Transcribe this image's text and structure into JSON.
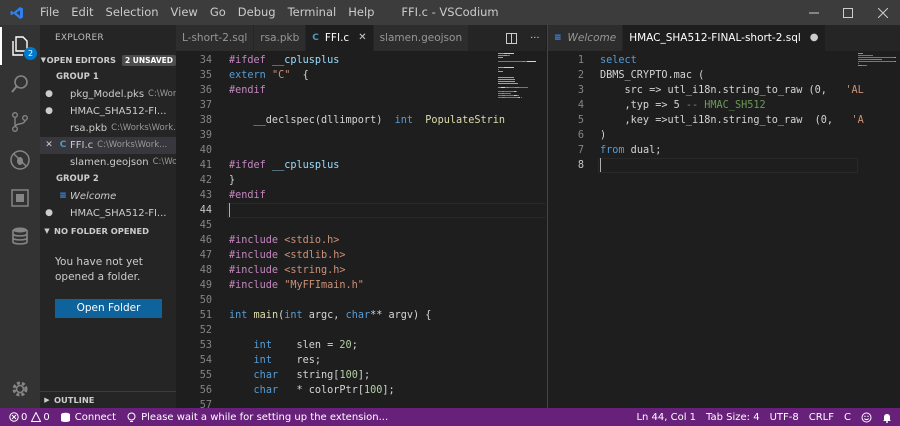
{
  "window": {
    "title": "FFI.c - VSCodium"
  },
  "menu": [
    "File",
    "Edit",
    "Selection",
    "View",
    "Go",
    "Debug",
    "Terminal",
    "Help"
  ],
  "activity": {
    "explorer_badge": "2"
  },
  "sidebar": {
    "title": "EXPLORER",
    "open_editors": {
      "label": "OPEN EDITORS",
      "badge": "2 UNSAVED"
    },
    "group1": {
      "label": "GROUP 1",
      "items": [
        {
          "mark": "●",
          "icon": "",
          "name": "pkg_Model.pks",
          "path": "C:\\Works\\W...",
          "icon_color": "#cccccc"
        },
        {
          "mark": "●",
          "icon": "",
          "name": "HMAC_SHA512-FI...",
          "path": "",
          "icon_color": "#cccccc"
        },
        {
          "mark": "",
          "icon": "",
          "name": "rsa.pkb",
          "path": "C:\\Works\\Work...",
          "icon_color": "#cccccc"
        },
        {
          "mark": "✕",
          "icon": "C",
          "name": "FFI.c",
          "path": "C:\\Works\\Work...",
          "icon_color": "#519aba"
        },
        {
          "mark": "",
          "icon": "",
          "name": "slamen.geojson",
          "path": "C:\\Works\\...",
          "icon_color": "#cccccc"
        }
      ]
    },
    "group2": {
      "label": "GROUP 2",
      "items": [
        {
          "mark": "",
          "icon": "≡",
          "name": "Welcome",
          "path": "",
          "icon_color": "#3794ff"
        },
        {
          "mark": "●",
          "icon": "",
          "name": "HMAC_SHA512-FI...",
          "path": "",
          "icon_color": "#cccccc"
        }
      ]
    },
    "no_folder": {
      "label": "NO FOLDER OPENED",
      "message": "You have not yet opened a folder.",
      "button": "Open Folder"
    },
    "outline": "OUTLINE"
  },
  "editor_left": {
    "tabs": [
      {
        "label": "L-short-2.sql",
        "icon": "",
        "active": false,
        "close": ""
      },
      {
        "label": "rsa.pkb",
        "icon": "",
        "active": false,
        "close": ""
      },
      {
        "label": "FFI.c",
        "icon": "C",
        "active": true,
        "close": "✕"
      },
      {
        "label": "slamen.geojson",
        "icon": "",
        "active": false,
        "close": ""
      }
    ],
    "current_line": "44",
    "lines": [
      {
        "n": "34",
        "tokens": [
          [
            "pp",
            "#ifdef "
          ],
          [
            "v",
            "__cplusplus"
          ]
        ]
      },
      {
        "n": "35",
        "tokens": [
          [
            "k",
            "extern "
          ],
          [
            "s",
            "\"C\""
          ],
          [
            "",
            "  {"
          ]
        ]
      },
      {
        "n": "36",
        "tokens": [
          [
            "pp",
            "#endif"
          ]
        ]
      },
      {
        "n": "37",
        "tokens": []
      },
      {
        "n": "38",
        "tokens": [
          [
            "",
            "    __declspec(dllimport)  "
          ],
          [
            "k",
            "int"
          ],
          [
            "",
            "  "
          ],
          [
            "f",
            "PopulateStrin"
          ]
        ]
      },
      {
        "n": "39",
        "tokens": []
      },
      {
        "n": "40",
        "tokens": []
      },
      {
        "n": "41",
        "tokens": [
          [
            "pp",
            "#ifdef "
          ],
          [
            "v",
            "__cplusplus"
          ]
        ]
      },
      {
        "n": "42",
        "tokens": [
          [
            "",
            "}"
          ]
        ]
      },
      {
        "n": "43",
        "tokens": [
          [
            "pp",
            "#endif"
          ]
        ]
      },
      {
        "n": "44",
        "tokens": []
      },
      {
        "n": "45",
        "tokens": []
      },
      {
        "n": "46",
        "tokens": [
          [
            "pp",
            "#include "
          ],
          [
            "s",
            "<stdio.h>"
          ]
        ]
      },
      {
        "n": "47",
        "tokens": [
          [
            "pp",
            "#include "
          ],
          [
            "s",
            "<stdlib.h>"
          ]
        ]
      },
      {
        "n": "48",
        "tokens": [
          [
            "pp",
            "#include "
          ],
          [
            "s",
            "<string.h>"
          ]
        ]
      },
      {
        "n": "49",
        "tokens": [
          [
            "pp",
            "#include "
          ],
          [
            "s",
            "\"MyFFImain.h\""
          ]
        ]
      },
      {
        "n": "50",
        "tokens": []
      },
      {
        "n": "51",
        "tokens": [
          [
            "k",
            "int"
          ],
          [
            "",
            ""
          ],
          [
            "f",
            " main"
          ],
          [
            "",
            "("
          ],
          [
            "k",
            "int"
          ],
          [
            "",
            " argc, "
          ],
          [
            "k",
            "char"
          ],
          [
            "",
            "** argv) {"
          ]
        ]
      },
      {
        "n": "52",
        "tokens": []
      },
      {
        "n": "53",
        "tokens": [
          [
            "",
            "    "
          ],
          [
            "k",
            "int"
          ],
          [
            "",
            "    slen = "
          ],
          [
            "n",
            "20"
          ],
          [
            "",
            ";"
          ]
        ]
      },
      {
        "n": "54",
        "tokens": [
          [
            "",
            "    "
          ],
          [
            "k",
            "int"
          ],
          [
            "",
            "    res;"
          ]
        ]
      },
      {
        "n": "55",
        "tokens": [
          [
            "",
            "    "
          ],
          [
            "k",
            "char"
          ],
          [
            "",
            "   string["
          ],
          [
            "n",
            "100"
          ],
          [
            "",
            "];"
          ]
        ]
      },
      {
        "n": "56",
        "tokens": [
          [
            "",
            "    "
          ],
          [
            "k",
            "char"
          ],
          [
            "",
            "   * colorPtr["
          ],
          [
            "n",
            "100"
          ],
          [
            "",
            "];"
          ]
        ]
      },
      {
        "n": "57",
        "tokens": []
      }
    ]
  },
  "editor_right": {
    "tabs": [
      {
        "label": "Welcome",
        "icon": "≡",
        "active": false,
        "close": ""
      },
      {
        "label": "HMAC_SHA512-FINAL-short-2.sql",
        "icon": "",
        "active": true,
        "close": "●"
      }
    ],
    "current_line": "8",
    "lines": [
      {
        "n": "1",
        "tokens": [
          [
            "k",
            "select"
          ]
        ]
      },
      {
        "n": "2",
        "tokens": [
          [
            "",
            "DBMS_CRYPTO.mac ("
          ]
        ]
      },
      {
        "n": "3",
        "tokens": [
          [
            "",
            "    src => utl_i18n.string_to_raw (0,   "
          ],
          [
            "s",
            "'AL"
          ]
        ]
      },
      {
        "n": "4",
        "tokens": [
          [
            "",
            "    ,typ => 5 "
          ],
          [
            "c",
            "-- HMAC_SH512"
          ]
        ]
      },
      {
        "n": "5",
        "tokens": [
          [
            "",
            "    ,key =>utl_i18n.string_to_raw  (0,   "
          ],
          [
            "s",
            "'A"
          ]
        ]
      },
      {
        "n": "6",
        "tokens": [
          [
            "",
            ")"
          ]
        ]
      },
      {
        "n": "7",
        "tokens": [
          [
            "k",
            "from"
          ],
          [
            "",
            " dual;"
          ]
        ]
      },
      {
        "n": "8",
        "tokens": []
      }
    ]
  },
  "statusbar": {
    "errors": "0",
    "warnings": "0",
    "connect": "Connect",
    "message": "Please wait a while for setting up the extension...",
    "position": "Ln 44, Col 1",
    "tab_size": "Tab Size: 4",
    "encoding": "UTF-8",
    "eol": "CRLF",
    "language": "C"
  },
  "colors": {
    "statusbar": "#68217a",
    "activity_bar": "#333333",
    "sidebar": "#252526",
    "editor": "#1e1e1e",
    "button": "#0e639c"
  }
}
